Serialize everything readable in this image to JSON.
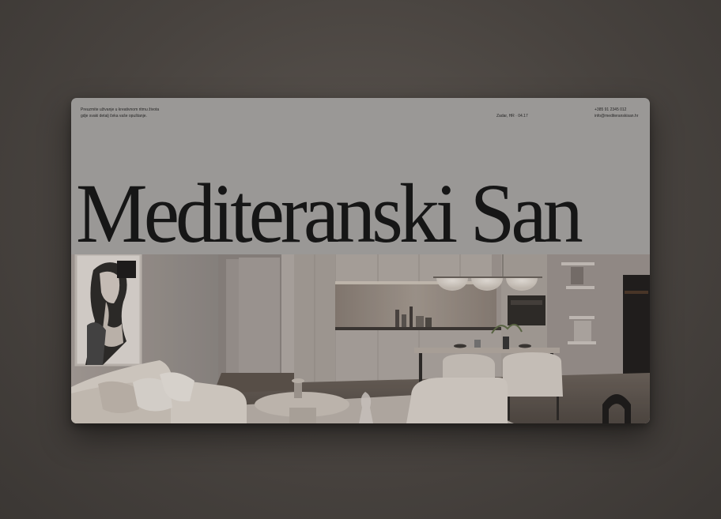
{
  "header": {
    "tagline_line1": "Preuzmite uživanje u kreativnom ritmu života",
    "tagline_line2": "gdje svaki detalj čeka vaše opuštanje.",
    "location": "Zadar, HR · 04.17",
    "phone": "+385 91 2345 012",
    "email": "info@mediteranskisan.hr"
  },
  "hero": {
    "title": "Mediteranski San"
  },
  "photo": {
    "subject": "interior-living-kitchen-dining"
  },
  "colors": {
    "page_background": "#4a4541",
    "card_background": "#9a9896",
    "title_text": "#161616"
  }
}
